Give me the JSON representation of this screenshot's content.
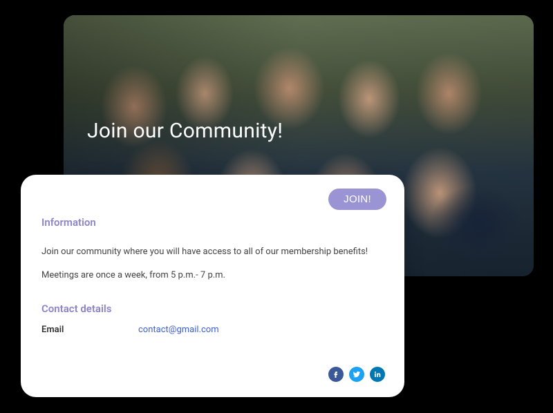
{
  "hero": {
    "title": "Join our Community!"
  },
  "card": {
    "join_button_label": "JOIN!",
    "info_heading": "Information",
    "info_line1": "Join our community where you will have access to all of our membership benefits!",
    "info_line2": "Meetings are once a week, from 5 p.m.- 7 p.m.",
    "contact_heading": "Contact details",
    "contact_label_email": "Email",
    "contact_email": "contact@gmail.com"
  },
  "socials": {
    "facebook": "facebook-icon",
    "twitter": "twitter-icon",
    "linkedin": "linkedin-icon"
  },
  "colors": {
    "accent": "#8a84c9",
    "button": "#9b94d4",
    "link": "#3b5fd8"
  }
}
